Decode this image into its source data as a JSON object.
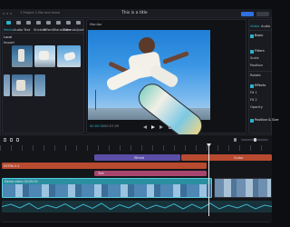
{
  "window": {
    "title": "This is a title",
    "left_title": "1 Project 1 file and more"
  },
  "media": {
    "tabs": [
      "Media",
      "Audio",
      "Text",
      "Stickers",
      "Effects",
      "Transitions",
      "Filters",
      "Adjust"
    ],
    "sub_items": [
      "Local",
      "Import",
      "Library"
    ]
  },
  "player": {
    "label": "Monitor",
    "time_current": "00:00:00",
    "time_total": "00:57:09"
  },
  "props": {
    "tabs": [
      "Video",
      "Audio",
      "Speed"
    ],
    "sections": [
      "Basic",
      "Filters",
      "Effects",
      "Position & Size"
    ],
    "rows": [
      "Scale",
      "Position",
      "Rotate",
      "Fit 1",
      "Fit 2",
      "Opacity"
    ]
  },
  "timeline": {
    "text_track_1": "Wheat",
    "text_track_1b": "Guitar",
    "text_track_2": "EXTRA 0.5",
    "sticker_clip": "Text",
    "video_label": "Demo video  00:00:00",
    "colors": {
      "text1": "#5b4ea8",
      "text2": "#b84a2f",
      "sticker": "#a8456e",
      "video": "#2a8fa0",
      "playhead": "#e6e6e6"
    }
  }
}
